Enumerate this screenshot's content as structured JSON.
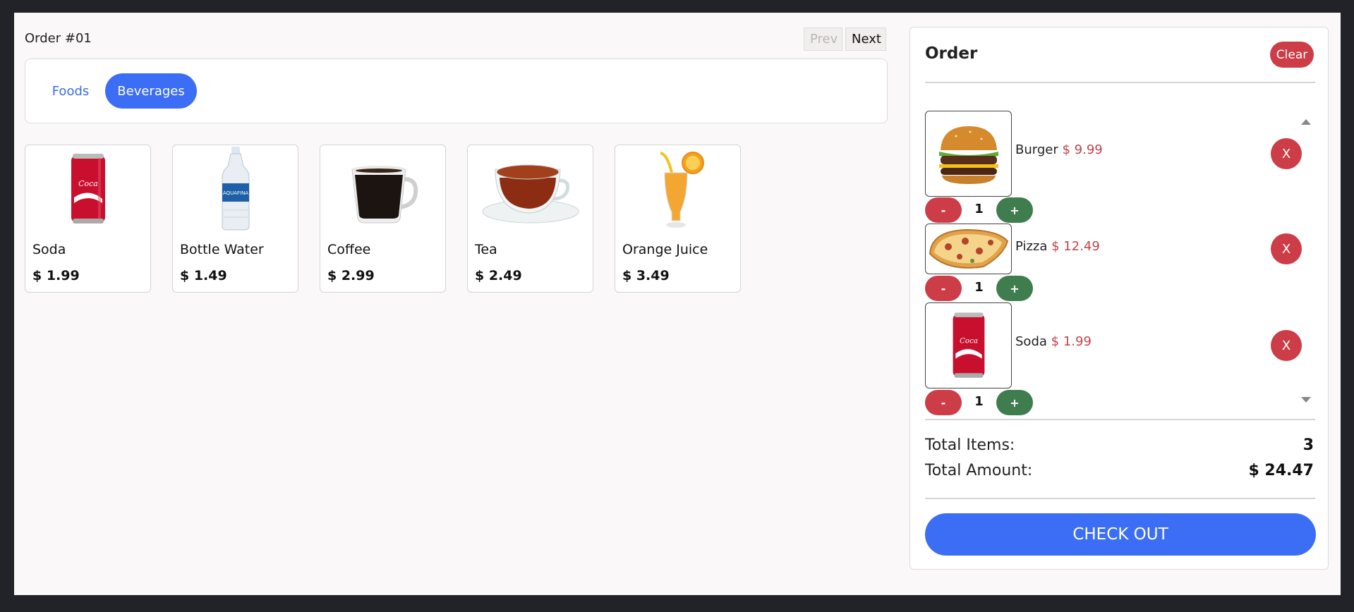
{
  "header": {
    "order_label": "Order #01",
    "prev_label": "Prev",
    "next_label": "Next"
  },
  "tabs": [
    {
      "label": "Foods",
      "active": false
    },
    {
      "label": "Beverages",
      "active": true
    }
  ],
  "products": [
    {
      "name": "Soda",
      "price": "$ 1.99",
      "icon": "soda-can-icon"
    },
    {
      "name": "Bottle Water",
      "price": "$ 1.49",
      "icon": "water-bottle-icon"
    },
    {
      "name": "Coffee",
      "price": "$ 2.99",
      "icon": "coffee-cup-icon"
    },
    {
      "name": "Tea",
      "price": "$ 2.49",
      "icon": "tea-cup-icon"
    },
    {
      "name": "Orange Juice",
      "price": "$ 3.49",
      "icon": "orange-juice-icon"
    }
  ],
  "order": {
    "title": "Order",
    "clear_label": "Clear",
    "items": [
      {
        "name": "Burger",
        "price": "$ 9.99",
        "qty": "1",
        "remove_label": "X",
        "minus_label": "-",
        "plus_label": "+",
        "icon": "burger-icon"
      },
      {
        "name": "Pizza",
        "price": "$ 12.49",
        "qty": "1",
        "remove_label": "X",
        "minus_label": "-",
        "plus_label": "+",
        "icon": "pizza-icon"
      },
      {
        "name": "Soda",
        "price": "$ 1.99",
        "qty": "1",
        "remove_label": "X",
        "minus_label": "-",
        "plus_label": "+",
        "icon": "soda-can-icon"
      }
    ],
    "total_items_label": "Total Items:",
    "total_items_value": "3",
    "total_amount_label": "Total Amount:",
    "total_amount_value": "$ 24.47",
    "checkout_label": "CHECK OUT"
  },
  "colors": {
    "primary": "#3c6ef5",
    "danger": "#cc3d47",
    "success": "#3f7d4f",
    "price_red": "#c5434b"
  }
}
